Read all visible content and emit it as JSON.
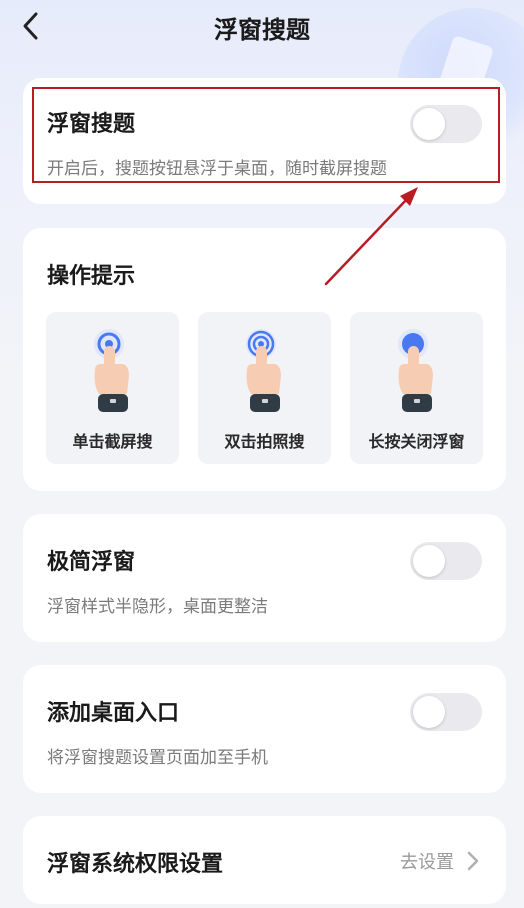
{
  "header": {
    "title": "浮窗搜题",
    "back_icon": "chevron-left-icon"
  },
  "floating_search": {
    "title": "浮窗搜题",
    "description": "开启后，搜题按钮悬浮于桌面，随时截屏搜题",
    "enabled": false
  },
  "tips": {
    "title": "操作提示",
    "items": [
      {
        "label": "单击截屏搜",
        "icon": "tap-hand-icon"
      },
      {
        "label": "双击拍照搜",
        "icon": "double-tap-hand-icon"
      },
      {
        "label": "长按关闭浮窗",
        "icon": "long-press-hand-icon"
      }
    ]
  },
  "minimal_float": {
    "title": "极简浮窗",
    "description": "浮窗样式半隐形，桌面更整洁",
    "enabled": false
  },
  "desktop_entry": {
    "title": "添加桌面入口",
    "description": "将浮窗搜题设置页面加至手机",
    "enabled": false
  },
  "permissions": {
    "title": "浮窗系统权限设置",
    "action": "去设置"
  },
  "colors": {
    "annotation": "#b81c24",
    "toggle_off": "#eaeaee",
    "tap_ring": "#4a78f0"
  }
}
